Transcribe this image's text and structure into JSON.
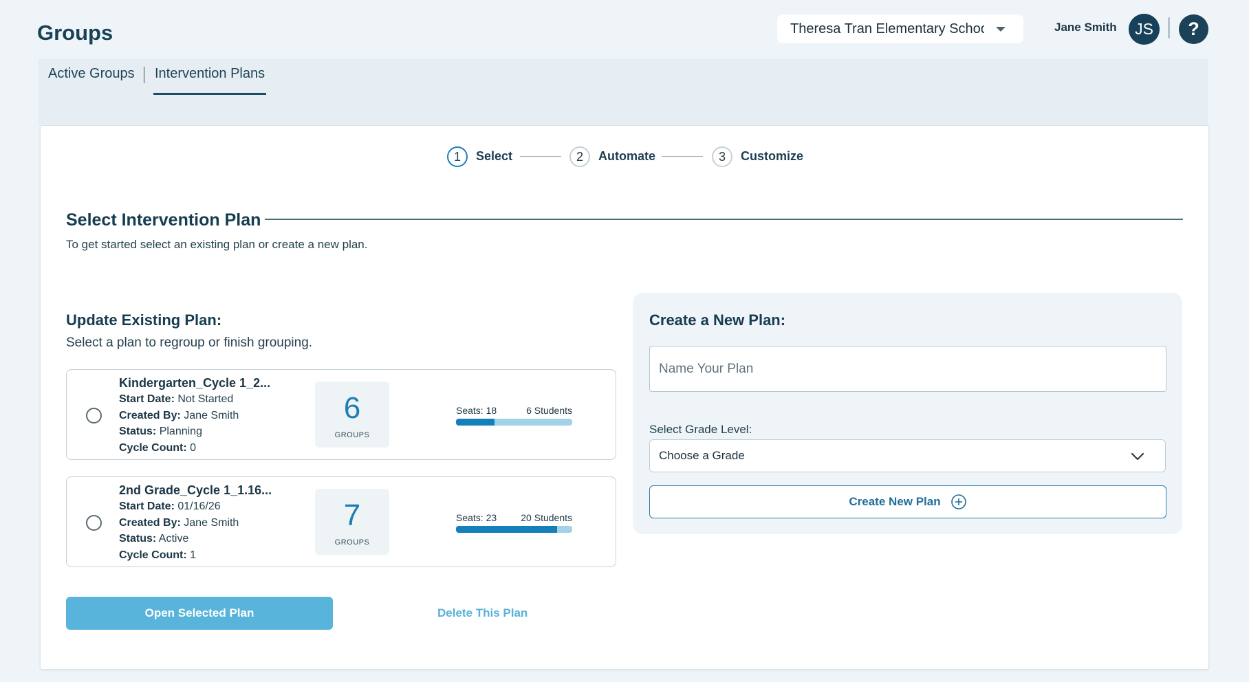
{
  "header": {
    "title": "Groups",
    "school_select": "Theresa Tran Elementary School",
    "user_name": "Jane Smith",
    "avatar_initials": "JS",
    "help_glyph": "?"
  },
  "tabs": [
    {
      "label": "Active Groups",
      "active": false
    },
    {
      "label": "Intervention Plans",
      "active": true
    }
  ],
  "stepper": [
    {
      "number": "1",
      "label": "Select",
      "active": true
    },
    {
      "number": "2",
      "label": "Automate",
      "active": false
    },
    {
      "number": "3",
      "label": "Customize",
      "active": false
    }
  ],
  "section": {
    "title": "Select Intervention Plan",
    "subtitle": "To get started select an existing plan or create a new plan."
  },
  "update": {
    "title": "Update Existing Plan:",
    "subtitle": "Select a plan to regroup or finish grouping."
  },
  "plans": [
    {
      "name": "Kindergarten_Cycle 1_2...",
      "start_label": "Start Date:",
      "start_value": "Not Started",
      "created_label": "Created By:",
      "created_value": "Jane Smith",
      "status_label": "Status:",
      "status_value": "Planning",
      "cycle_label": "Cycle Count:",
      "cycle_value": "0",
      "groups": "6",
      "groups_label": "GROUPS",
      "seats_label": "Seats: 18",
      "students_label": "6 Students",
      "fill_fraction": 0.333
    },
    {
      "name": "2nd Grade_Cycle 1_1.16...",
      "start_label": "Start Date:",
      "start_value": "01/16/26",
      "created_label": "Created By:",
      "created_value": "Jane Smith",
      "status_label": "Status:",
      "status_value": "Active",
      "cycle_label": "Cycle Count:",
      "cycle_value": "1",
      "groups": "7",
      "groups_label": "GROUPS",
      "seats_label": "Seats: 23",
      "students_label": "20 Students",
      "fill_fraction": 0.87
    }
  ],
  "actions": {
    "open_label": "Open Selected Plan",
    "delete_label": "Delete This Plan"
  },
  "create": {
    "title": "Create a New Plan:",
    "name_placeholder": "Name Your Plan",
    "grade_label": "Select Grade Level:",
    "grade_value": "Choose a Grade",
    "button_label": "Create New Plan"
  },
  "colors": {
    "primary_dark": "#163c50",
    "accent_blue": "#1480b9",
    "light_blue": "#58b4da",
    "panel_bg": "#eef4f8"
  },
  "icons": {
    "dropdown": "caret-down-icon",
    "chevron": "chevron-down-icon",
    "plus": "plus-circle-icon",
    "help": "question-icon"
  }
}
